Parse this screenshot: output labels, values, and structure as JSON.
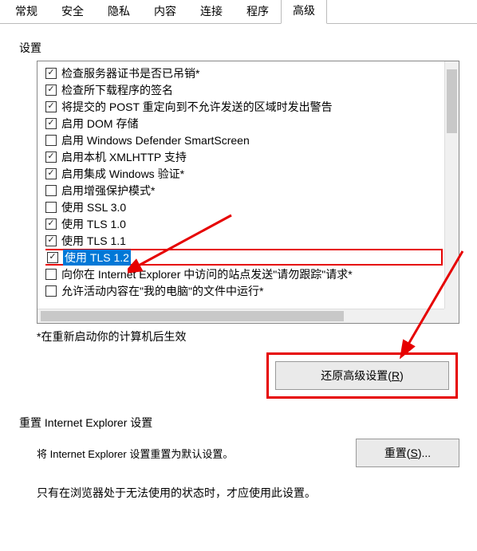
{
  "tabs": [
    "常规",
    "安全",
    "隐私",
    "内容",
    "连接",
    "程序",
    "高级"
  ],
  "activeTabIndex": 6,
  "settingsLabel": "设置",
  "settings": [
    {
      "checked": true,
      "label": "检查服务器证书是否已吊销*"
    },
    {
      "checked": true,
      "label": "检查所下载程序的签名"
    },
    {
      "checked": true,
      "label": "将提交的 POST 重定向到不允许发送的区域时发出警告"
    },
    {
      "checked": true,
      "label": "启用 DOM 存储"
    },
    {
      "checked": false,
      "label": "启用 Windows Defender SmartScreen"
    },
    {
      "checked": true,
      "label": "启用本机 XMLHTTP 支持"
    },
    {
      "checked": true,
      "label": "启用集成 Windows 验证*"
    },
    {
      "checked": false,
      "label": "启用增强保护模式*"
    },
    {
      "checked": false,
      "label": "使用 SSL 3.0"
    },
    {
      "checked": true,
      "label": "使用 TLS 1.0"
    },
    {
      "checked": true,
      "label": "使用 TLS 1.1"
    },
    {
      "checked": true,
      "label": "使用 TLS 1.2",
      "highlighted": true
    },
    {
      "checked": false,
      "label": "向你在 Internet Explorer 中访问的站点发送\"请勿跟踪\"请求*"
    },
    {
      "checked": false,
      "label": "允许活动内容在\"我的电脑\"的文件中运行*"
    }
  ],
  "note": "*在重新启动你的计算机后生效",
  "restoreBtn": "还原高级设置(R)",
  "resetTitle": "重置 Internet Explorer 设置",
  "resetDesc": "将 Internet Explorer 设置重置为默认设置。",
  "resetBtn": "重置(S)...",
  "resetNote": "只有在浏览器处于无法使用的状态时，才应使用此设置。"
}
